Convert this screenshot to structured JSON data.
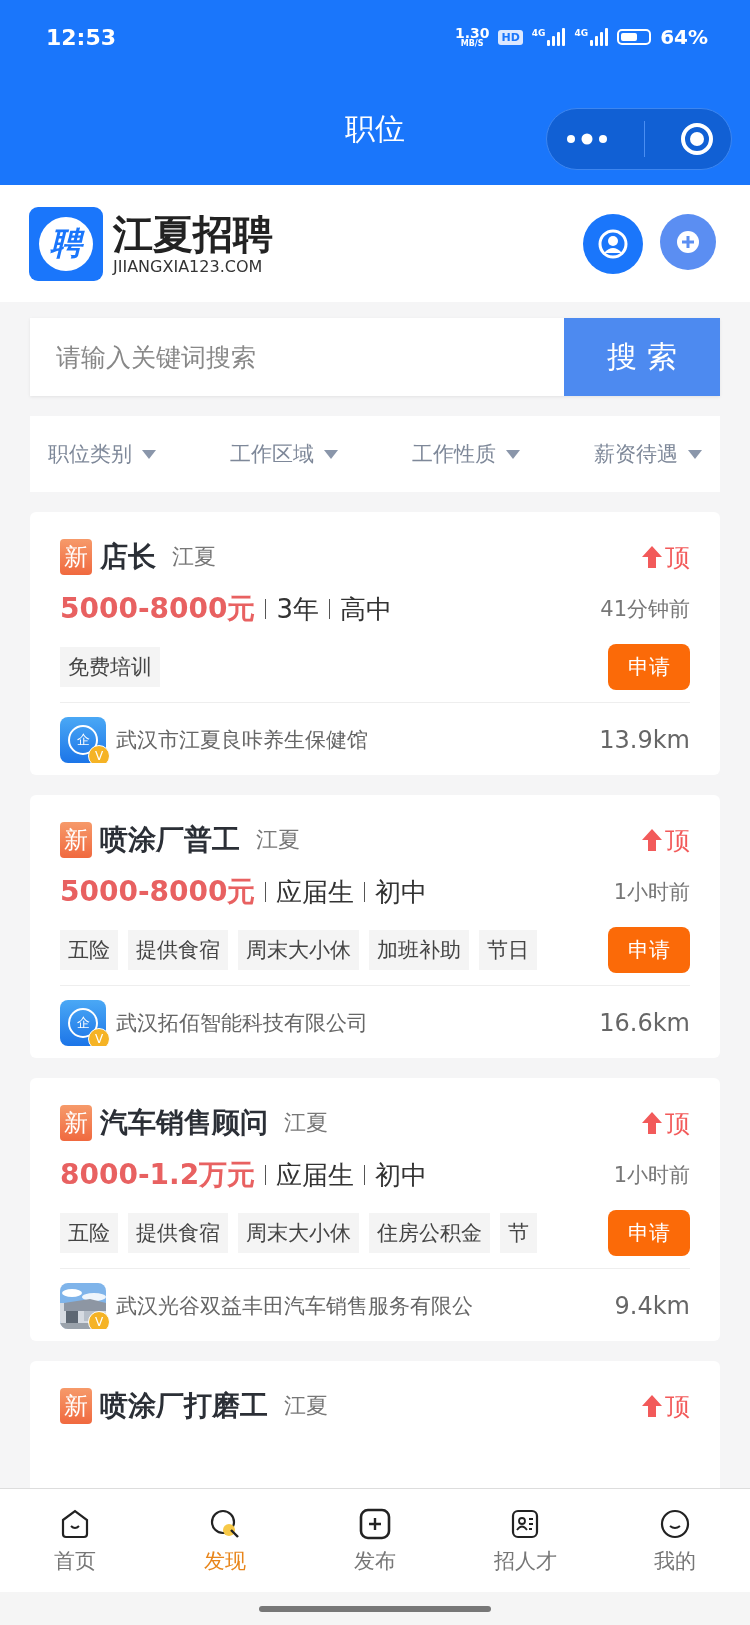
{
  "status_bar": {
    "time": "12:53",
    "speed": "1.30",
    "speed_unit": "MB/S",
    "hd": "HD",
    "networks": [
      "4G",
      "4G"
    ],
    "battery": "64%"
  },
  "nav_bar": {
    "title": "职位"
  },
  "header": {
    "logo_char": "聘",
    "brand": "江夏招聘",
    "domain": "JIIANGXIA123.COM"
  },
  "search": {
    "placeholder": "请输入关键词搜索",
    "button": "搜 索"
  },
  "filters": [
    {
      "label": "职位类别"
    },
    {
      "label": "工作区域"
    },
    {
      "label": "工作性质"
    },
    {
      "label": "薪资待遇"
    }
  ],
  "jobs": [
    {
      "badge": "新",
      "title": "店长",
      "area": "江夏",
      "top": "顶",
      "salary": "5000-8000元",
      "experience": "3年",
      "education": "高中",
      "time": "41分钟前",
      "tags": [
        "免费培训"
      ],
      "apply": "申请",
      "company": "武汉市江夏良咔养生保健馆",
      "distance": "13.9km",
      "logo": {
        "kind": "icon",
        "mark": "企",
        "badge": "V"
      }
    },
    {
      "badge": "新",
      "title": "喷涂厂普工",
      "area": "江夏",
      "top": "顶",
      "salary": "5000-8000元",
      "experience": "应届生",
      "education": "初中",
      "time": "1小时前",
      "tags": [
        "五险",
        "提供食宿",
        "周末大小休",
        "加班补助",
        "节日"
      ],
      "apply": "申请",
      "company": "武汉拓佰智能科技有限公司",
      "distance": "16.6km",
      "logo": {
        "kind": "icon",
        "mark": "企",
        "badge": "V"
      }
    },
    {
      "badge": "新",
      "title": "汽车销售顾问",
      "area": "江夏",
      "top": "顶",
      "salary": "8000-1.2万元",
      "experience": "应届生",
      "education": "初中",
      "time": "1小时前",
      "tags": [
        "五险",
        "提供食宿",
        "周末大小休",
        "住房公积金",
        "节"
      ],
      "apply": "申请",
      "company": "武汉光谷双益丰田汽车销售服务有限公",
      "distance": "9.4km",
      "logo": {
        "kind": "picture",
        "badge": "V"
      }
    },
    {
      "badge": "新",
      "title": "喷涂厂打磨工",
      "area": "江夏",
      "top": "顶"
    }
  ],
  "tab_bar": [
    {
      "label": "首页",
      "kind": "home",
      "selected": false
    },
    {
      "label": "发现",
      "kind": "discover",
      "selected": true
    },
    {
      "label": "发布",
      "kind": "publish",
      "selected": false
    },
    {
      "label": "招人才",
      "kind": "talent",
      "selected": false
    },
    {
      "label": "我的",
      "kind": "me",
      "selected": false
    }
  ]
}
